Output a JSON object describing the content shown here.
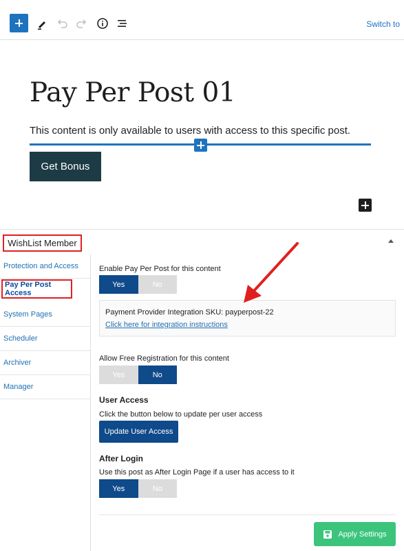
{
  "toolbar": {
    "icons": [
      "plus-icon",
      "pencil-icon",
      "undo-icon",
      "redo-icon",
      "info-icon",
      "list-view-icon"
    ],
    "switch_label": "Switch to"
  },
  "post": {
    "title": "Pay Per Post 01",
    "paragraph": "This content is only available to users with access to this specific post.",
    "button_label": "Get Bonus"
  },
  "metabox": {
    "title": "WishList Member",
    "sidebar": {
      "items": [
        {
          "label": "Protection and Access",
          "active": false
        },
        {
          "label": "Pay Per Post Access",
          "active": true
        },
        {
          "label": "System Pages",
          "active": false
        },
        {
          "label": "Scheduler",
          "active": false
        },
        {
          "label": "Archiver",
          "active": false
        },
        {
          "label": "Manager",
          "active": false
        }
      ]
    },
    "enable_ppp": {
      "label": "Enable Pay Per Post for this content",
      "yes": "Yes",
      "no": "No",
      "selected": "Yes"
    },
    "sku": {
      "text": "Payment Provider Integration SKU: payperpost-22",
      "link": "Click here for integration instructions"
    },
    "free_reg": {
      "label": "Allow Free Registration for this content",
      "yes": "Yes",
      "no": "No",
      "selected": "No"
    },
    "user_access": {
      "heading": "User Access",
      "description": "Click the button below to update per user access",
      "button_label": "Update User Access"
    },
    "after_login": {
      "heading": "After Login",
      "description": "Use this post as After Login Page if a user has access to it",
      "yes": "Yes",
      "no": "No",
      "selected": "Yes"
    },
    "apply_label": "Apply Settings"
  },
  "colors": {
    "accent": "#1e73be",
    "primary_dark": "#0f4a8a",
    "bonus_button": "#1d3b45",
    "apply_button": "#3cc47c",
    "annotation": "#e02020"
  }
}
